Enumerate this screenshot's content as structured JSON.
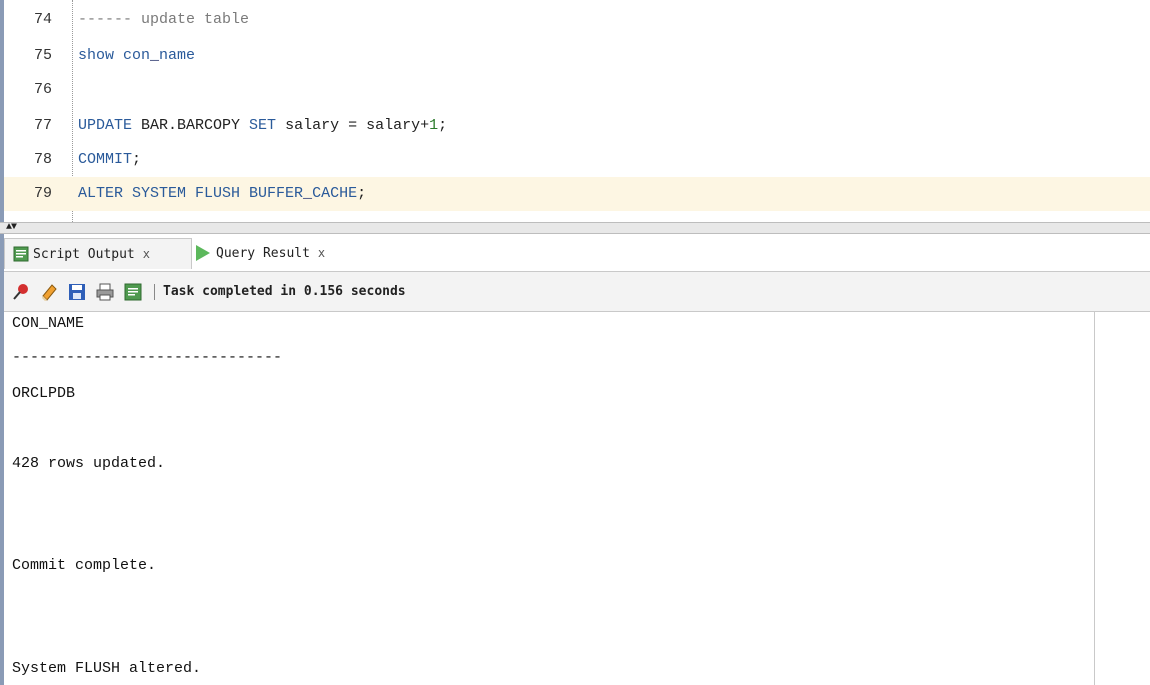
{
  "editor": {
    "lines": [
      {
        "num": "74",
        "text": "------ update table"
      },
      {
        "num": "75",
        "text": "show con_name"
      },
      {
        "num": "76",
        "text": ""
      },
      {
        "num": "77",
        "text": "UPDATE BAR.BARCOPY SET salary = salary+1;"
      },
      {
        "num": "78",
        "text": "COMMIT;"
      },
      {
        "num": "79",
        "text": "ALTER SYSTEM FLUSH BUFFER_CACHE;"
      }
    ],
    "tokens": {
      "l74": "------ update table",
      "l75_kw": "show con",
      "l75_sep": "_",
      "l75_rest": "name",
      "l77_kw1": "UPDATE",
      "l77_mid": " BAR.BARCOPY ",
      "l77_kw2": "SET",
      "l77_rest": " salary = salary+",
      "l77_num": "1",
      "l77_end": ";",
      "l78_kw": "COMMIT",
      "l78_end": ";",
      "l79_kw": "ALTER SYSTEM FLUSH BUFFER",
      "l79_sep": "_",
      "l79_rest": "CACHE",
      "l79_end": ";"
    }
  },
  "tabs": [
    {
      "label": "Script Output",
      "close": "x",
      "active": true,
      "icon": "script-output-icon"
    },
    {
      "label": "Query Result",
      "close": "x",
      "active": false,
      "icon": "run-icon"
    }
  ],
  "toolbar": {
    "icons": [
      "pin-icon",
      "eraser-icon",
      "save-icon",
      "print-icon",
      "open-file-icon"
    ],
    "status": "Task completed in 0.156 seconds"
  },
  "output": {
    "lines": [
      "CON_NAME",
      "------------------------------",
      "ORCLPDB",
      "428 rows updated.",
      "Commit complete.",
      "System FLUSH altered."
    ]
  },
  "colors": {
    "keyword": "#2a5a9a",
    "comment": "#7a7a7a",
    "number": "#2a7a2a",
    "current_line": "#fdf6e3"
  }
}
